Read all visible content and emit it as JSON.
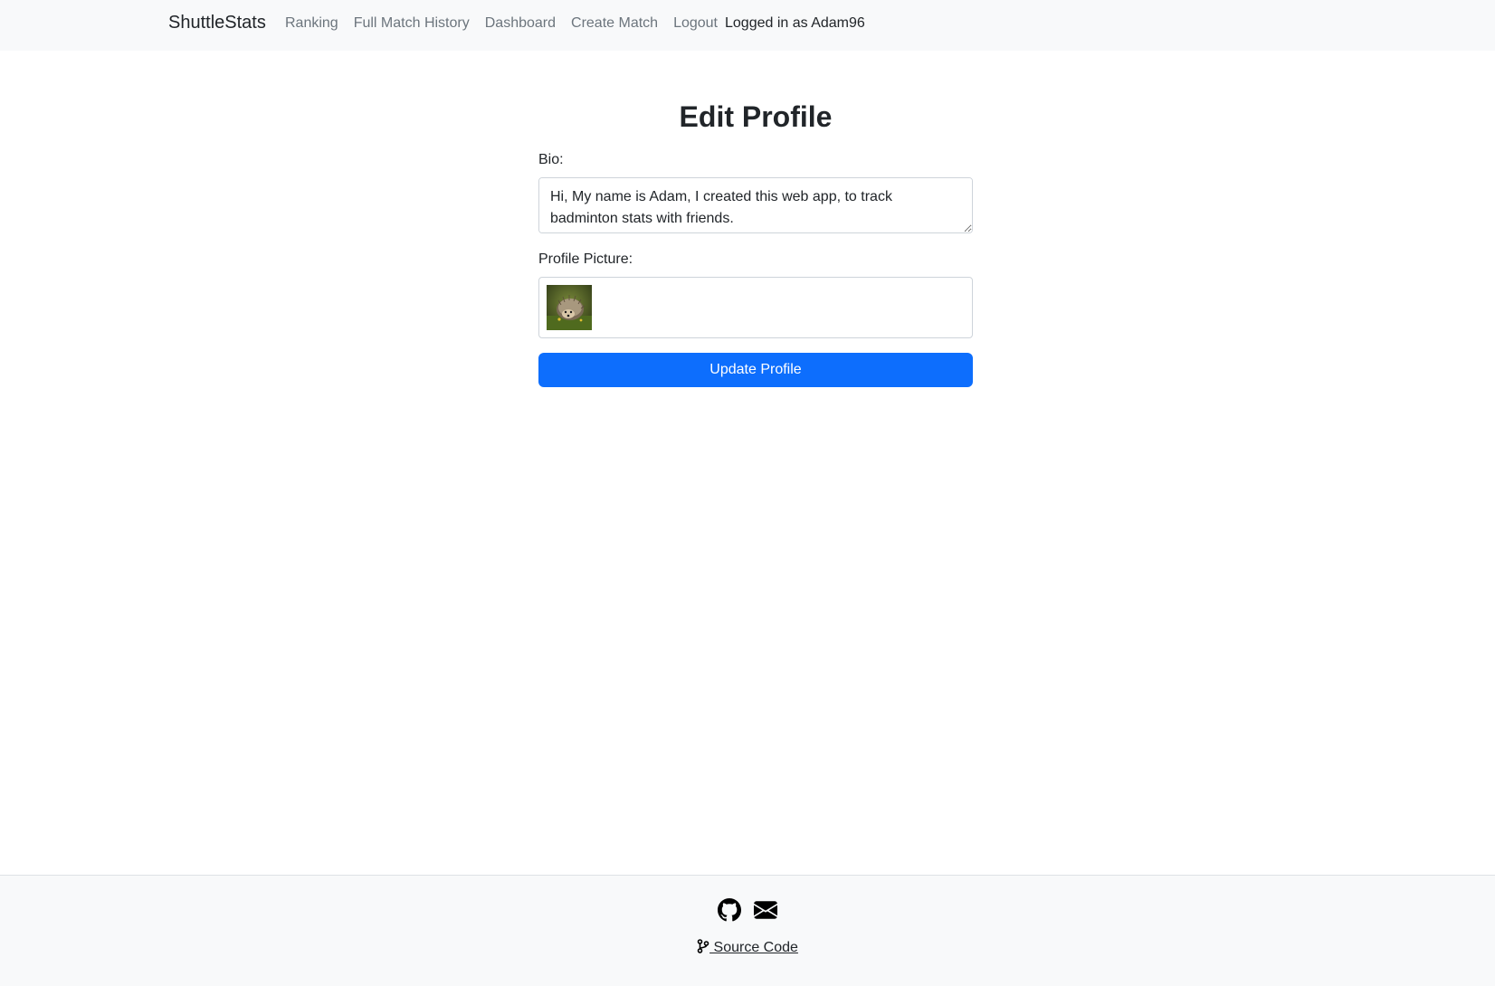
{
  "navbar": {
    "brand": "ShuttleStats",
    "links": [
      "Ranking",
      "Full Match History",
      "Dashboard",
      "Create Match",
      "Logout"
    ],
    "user_status": "Logged in as Adam96"
  },
  "page": {
    "title": "Edit Profile"
  },
  "form": {
    "bio_label": "Bio:",
    "bio_value": "Hi, My name is Adam, I created this web app, to track badminton stats with friends.",
    "picture_label": "Profile Picture:",
    "picture_alt": "hedgehog profile picture",
    "submit_label": "Update Profile"
  },
  "footer": {
    "icons": [
      "github-icon",
      "envelope-icon"
    ],
    "source_label": " Source Code"
  },
  "colors": {
    "primary": "#0d6efd",
    "navbar_bg": "#f8f9fa"
  }
}
